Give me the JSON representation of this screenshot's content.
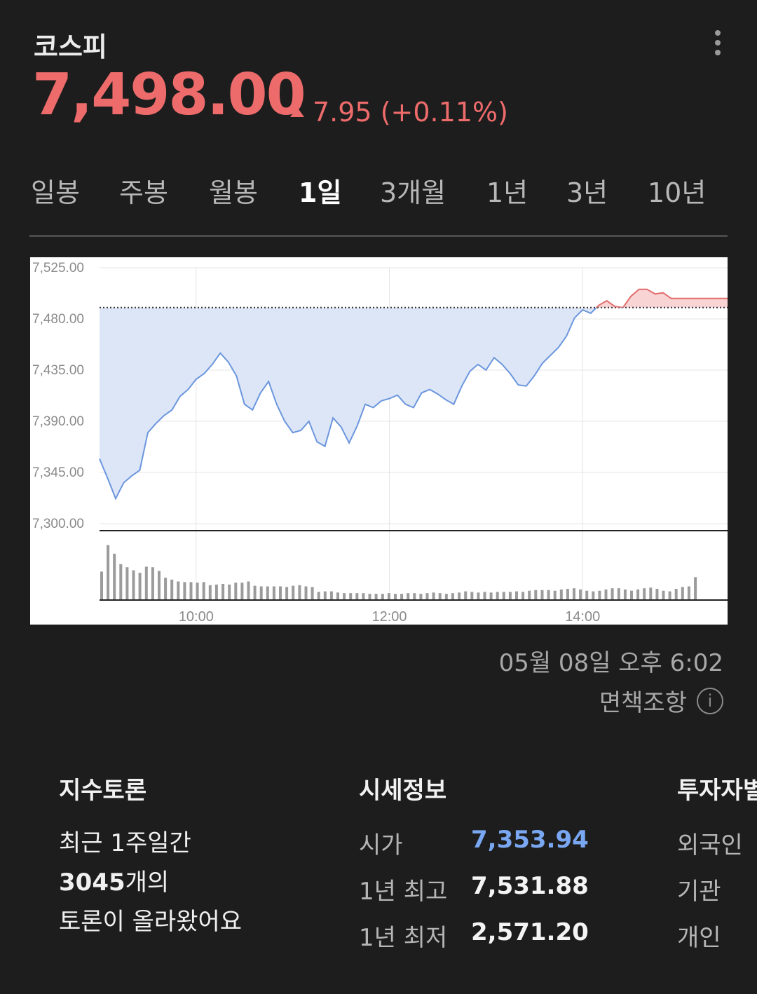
{
  "header": {
    "title": "코스피",
    "price": "7,498.00",
    "change": "7.95 (+0.11%)",
    "up_color": "#ee6b6b"
  },
  "tabs": [
    {
      "label": "일봉",
      "active": false
    },
    {
      "label": "주봉",
      "active": false
    },
    {
      "label": "월봉",
      "active": false
    },
    {
      "label": "1일",
      "active": true
    },
    {
      "label": "3개월",
      "active": false
    },
    {
      "label": "1년",
      "active": false
    },
    {
      "label": "3년",
      "active": false
    },
    {
      "label": "10년",
      "active": false
    }
  ],
  "chart_data": {
    "type": "area",
    "ylim": [
      7300,
      7525
    ],
    "yticks": [
      "7,525.00",
      "7,480.00",
      "7,435.00",
      "7,390.00",
      "7,345.00",
      "7,300.00"
    ],
    "xticks": [
      "10:00",
      "12:00",
      "14:00"
    ],
    "prev_close": 7490.05,
    "colors": {
      "below": "#6b96dd",
      "below_fill": "#dde6f7",
      "above": "#e26d6d",
      "above_fill": "#f9d4d4"
    },
    "series": [
      {
        "x": "09:00",
        "y": 7357
      },
      {
        "x": "09:05",
        "y": 7340
      },
      {
        "x": "09:10",
        "y": 7322
      },
      {
        "x": "09:15",
        "y": 7336
      },
      {
        "x": "09:20",
        "y": 7342
      },
      {
        "x": "09:25",
        "y": 7347
      },
      {
        "x": "09:30",
        "y": 7380
      },
      {
        "x": "09:35",
        "y": 7388
      },
      {
        "x": "09:40",
        "y": 7395
      },
      {
        "x": "09:45",
        "y": 7400
      },
      {
        "x": "09:50",
        "y": 7412
      },
      {
        "x": "09:55",
        "y": 7418
      },
      {
        "x": "10:00",
        "y": 7427
      },
      {
        "x": "10:05",
        "y": 7432
      },
      {
        "x": "10:10",
        "y": 7440
      },
      {
        "x": "10:15",
        "y": 7450
      },
      {
        "x": "10:20",
        "y": 7442
      },
      {
        "x": "10:25",
        "y": 7430
      },
      {
        "x": "10:30",
        "y": 7405
      },
      {
        "x": "10:35",
        "y": 7400
      },
      {
        "x": "10:40",
        "y": 7415
      },
      {
        "x": "10:45",
        "y": 7425
      },
      {
        "x": "10:50",
        "y": 7405
      },
      {
        "x": "10:55",
        "y": 7390
      },
      {
        "x": "11:00",
        "y": 7380
      },
      {
        "x": "11:05",
        "y": 7382
      },
      {
        "x": "11:10",
        "y": 7390
      },
      {
        "x": "11:15",
        "y": 7372
      },
      {
        "x": "11:20",
        "y": 7368
      },
      {
        "x": "11:25",
        "y": 7393
      },
      {
        "x": "11:30",
        "y": 7385
      },
      {
        "x": "11:35",
        "y": 7371
      },
      {
        "x": "11:40",
        "y": 7386
      },
      {
        "x": "11:45",
        "y": 7405
      },
      {
        "x": "11:50",
        "y": 7402
      },
      {
        "x": "11:55",
        "y": 7408
      },
      {
        "x": "12:00",
        "y": 7410
      },
      {
        "x": "12:05",
        "y": 7413
      },
      {
        "x": "12:10",
        "y": 7405
      },
      {
        "x": "12:15",
        "y": 7402
      },
      {
        "x": "12:20",
        "y": 7415
      },
      {
        "x": "12:25",
        "y": 7418
      },
      {
        "x": "12:30",
        "y": 7414
      },
      {
        "x": "12:35",
        "y": 7409
      },
      {
        "x": "12:40",
        "y": 7405
      },
      {
        "x": "12:45",
        "y": 7421
      },
      {
        "x": "12:50",
        "y": 7434
      },
      {
        "x": "12:55",
        "y": 7440
      },
      {
        "x": "13:00",
        "y": 7435
      },
      {
        "x": "13:05",
        "y": 7446
      },
      {
        "x": "13:10",
        "y": 7440
      },
      {
        "x": "13:15",
        "y": 7432
      },
      {
        "x": "13:20",
        "y": 7422
      },
      {
        "x": "13:25",
        "y": 7421
      },
      {
        "x": "13:30",
        "y": 7430
      },
      {
        "x": "13:35",
        "y": 7441
      },
      {
        "x": "13:40",
        "y": 7448
      },
      {
        "x": "13:45",
        "y": 7455
      },
      {
        "x": "13:50",
        "y": 7465
      },
      {
        "x": "13:55",
        "y": 7481
      },
      {
        "x": "14:00",
        "y": 7488
      },
      {
        "x": "14:05",
        "y": 7485
      },
      {
        "x": "14:10",
        "y": 7492
      },
      {
        "x": "14:15",
        "y": 7496
      },
      {
        "x": "14:20",
        "y": 7491
      },
      {
        "x": "14:25",
        "y": 7490
      },
      {
        "x": "14:30",
        "y": 7500
      },
      {
        "x": "14:35",
        "y": 7506
      },
      {
        "x": "14:40",
        "y": 7506
      },
      {
        "x": "14:45",
        "y": 7502
      },
      {
        "x": "14:50",
        "y": 7503
      },
      {
        "x": "14:55",
        "y": 7498
      },
      {
        "x": "15:00",
        "y": 7498
      },
      {
        "x": "15:30",
        "y": 7498
      }
    ],
    "volume": [
      0.45,
      0.88,
      0.74,
      0.57,
      0.52,
      0.47,
      0.43,
      0.53,
      0.52,
      0.46,
      0.35,
      0.32,
      0.29,
      0.28,
      0.28,
      0.27,
      0.28,
      0.23,
      0.24,
      0.25,
      0.24,
      0.27,
      0.27,
      0.29,
      0.22,
      0.21,
      0.21,
      0.21,
      0.21,
      0.2,
      0.22,
      0.23,
      0.21,
      0.2,
      0.12,
      0.13,
      0.13,
      0.11,
      0.1,
      0.1,
      0.1,
      0.1,
      0.09,
      0.09,
      0.09,
      0.1,
      0.09,
      0.09,
      0.1,
      0.1,
      0.09,
      0.1,
      0.11,
      0.1,
      0.09,
      0.1,
      0.11,
      0.13,
      0.12,
      0.11,
      0.12,
      0.11,
      0.12,
      0.12,
      0.12,
      0.13,
      0.12,
      0.14,
      0.15,
      0.15,
      0.15,
      0.14,
      0.16,
      0.17,
      0.18,
      0.16,
      0.14,
      0.13,
      0.14,
      0.16,
      0.18,
      0.18,
      0.16,
      0.14,
      0.16,
      0.18,
      0.19,
      0.17,
      0.14,
      0.13,
      0.17,
      0.2,
      0.21,
      0.36
    ]
  },
  "timestamp": "05월 08일 오후 6:02",
  "disclaimer": "면책조항",
  "discussion": {
    "title": "지수토론",
    "line1": "최근 1주일간",
    "line2_count": "3045",
    "line2_suffix": "개의",
    "line3": "토론이 올라왔어요"
  },
  "quote_info": {
    "title": "시세정보",
    "rows": [
      {
        "label": "시가",
        "value": "7,353.94"
      },
      {
        "label": "1년 최고",
        "value": "7,531.88"
      },
      {
        "label": "1년 최저",
        "value": "2,571.20"
      }
    ]
  },
  "investor": {
    "title": "투자자별",
    "items": [
      "외국인",
      "기관",
      "개인"
    ]
  }
}
